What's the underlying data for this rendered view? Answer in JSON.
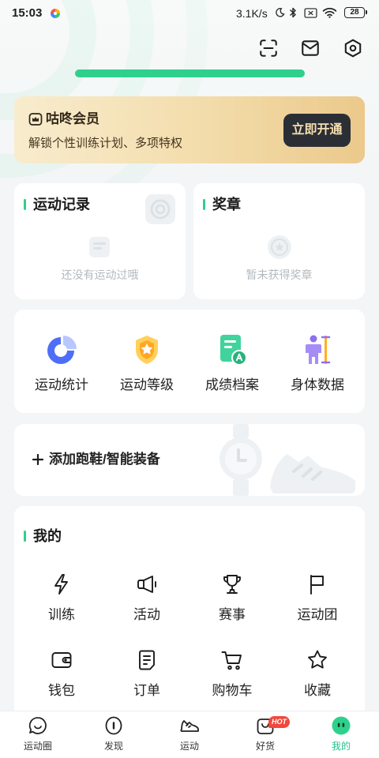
{
  "status_bar": {
    "time": "15:03",
    "network_speed": "3.1K/s",
    "battery": "28",
    "icons": [
      "app-pinwheel-icon",
      "moon-icon",
      "bluetooth-icon",
      "sim-off-icon",
      "wifi-icon",
      "battery-icon"
    ]
  },
  "header": {
    "icons": [
      "scan-icon",
      "mail-icon",
      "settings-icon"
    ]
  },
  "membership": {
    "title": "咕咚会员",
    "subtitle": "解锁个性训练计划、多项特权",
    "button_label": "立即开通",
    "icon": "vip-crown-icon"
  },
  "records": {
    "title": "运动记录",
    "empty_text": "还没有运动过哦"
  },
  "medals": {
    "title": "奖章",
    "empty_text": "暂未获得奖章"
  },
  "shortcuts": [
    {
      "label": "运动统计",
      "icon": "pie-chart-icon"
    },
    {
      "label": "运动等级",
      "icon": "level-badge-icon"
    },
    {
      "label": "成绩档案",
      "icon": "score-file-icon"
    },
    {
      "label": "身体数据",
      "icon": "body-data-icon"
    }
  ],
  "equipment": {
    "label": "添加跑鞋/智能装备",
    "icon": "plus-icon"
  },
  "mine": {
    "title": "我的",
    "items": [
      {
        "label": "训练",
        "icon": "lightning-icon"
      },
      {
        "label": "活动",
        "icon": "megaphone-icon"
      },
      {
        "label": "赛事",
        "icon": "trophy-icon"
      },
      {
        "label": "运动团",
        "icon": "flag-icon"
      },
      {
        "label": "钱包",
        "icon": "wallet-icon"
      },
      {
        "label": "订单",
        "icon": "order-icon"
      },
      {
        "label": "购物车",
        "icon": "cart-icon"
      },
      {
        "label": "收藏",
        "icon": "star-icon"
      }
    ]
  },
  "bottom_nav": {
    "items": [
      {
        "label": "运动圈",
        "icon": "chat-smile-icon"
      },
      {
        "label": "发现",
        "icon": "discover-icon"
      },
      {
        "label": "运动",
        "icon": "sneaker-icon"
      },
      {
        "label": "好货",
        "icon": "shopping-bag-icon",
        "badge": "HOT"
      },
      {
        "label": "我的",
        "icon": "profile-face-icon",
        "active": true
      }
    ]
  },
  "colors": {
    "accent_green": "#2ecf8d",
    "vip_gold": "#f3dcaa",
    "vip_button": "#2b2f35",
    "hot_badge": "#f2473d"
  }
}
